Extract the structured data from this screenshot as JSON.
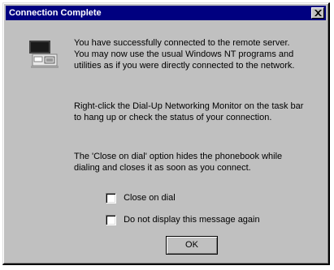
{
  "window": {
    "title": "Connection Complete",
    "close_icon": "close-icon"
  },
  "dialog": {
    "icon": "network-connection-icon",
    "message_1": "You have successfully connected to the remote server. You may now use the usual Windows NT programs and utilities as if you were directly connected to the network.",
    "message_2": "Right-click the Dial-Up Networking Monitor on the task bar to hang up or check the status of your connection.",
    "message_3": "The 'Close on dial' option hides the phonebook while dialing and closes it as soon as you connect."
  },
  "options": {
    "close_on_dial_label": "Close on dial",
    "close_on_dial_checked": false,
    "do_not_display_label": "Do not display this message again",
    "do_not_display_checked": false
  },
  "buttons": {
    "ok_label": "OK"
  }
}
